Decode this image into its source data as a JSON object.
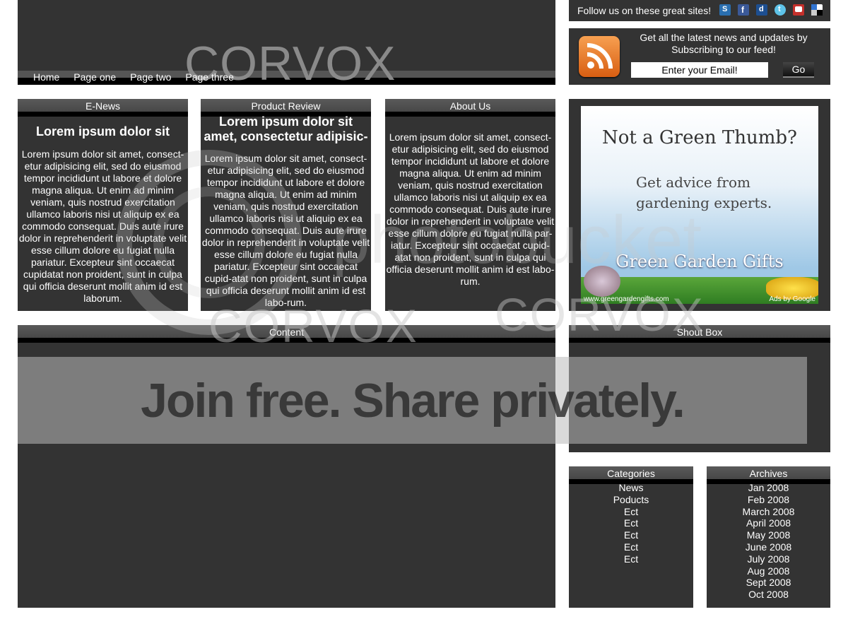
{
  "header": {
    "logo": "CORVOX",
    "nav": [
      "Home",
      "Page one",
      "Page two",
      "Page three"
    ]
  },
  "follow": {
    "text": "Follow us on these great sites!",
    "icons": [
      "stumbleupon-icon",
      "facebook-icon",
      "digg-icon",
      "twitter-icon",
      "youtube-icon",
      "delicious-icon"
    ]
  },
  "feed": {
    "text": "Get all the latest news and updates by Subscribing to our feed!",
    "email_value": "Enter your Email!",
    "go_label": "Go"
  },
  "enews": {
    "title": "E-News",
    "heading": "Lorem ipsum dolor sit",
    "body": "Lorem ipsum dolor sit amet, consect-etur adipisicing elit, sed do eiusmod tempor incididunt ut labore et dolore magna aliqua. Ut enim ad minim veniam, quis nostrud exercitation ullamco laboris nisi ut aliquip ex ea commodo consequat. Duis aute irure dolor in reprehenderit in voluptate velit esse cillum dolore eu fugiat nulla pariatur. Excepteur sint occaecat cupidatat non proident, sunt in culpa qui officia deserunt mollit anim id est laborum."
  },
  "review": {
    "title": "Product Review",
    "heading": "Lorem ipsum dolor sit amet, consectetur adipisic-",
    "body": "Lorem ipsum dolor sit amet, consect-etur adipisicing elit, sed do eiusmod tempor incididunt ut labore et dolore magna aliqua. Ut enim ad minim veniam, quis nostrud exercitation ullamco laboris nisi ut aliquip ex ea commodo consequat. Duis aute irure dolor in reprehenderit in voluptate velit esse cillum dolore eu fugiat nulla pariatur. Excepteur sint occaecat cupid-atat non proident, sunt in culpa qui officia deserunt mollit anim id est labo-rum."
  },
  "about": {
    "title": "About Us",
    "body": "Lorem ipsum dolor sit amet, consect-etur adipisicing elit, sed do eiusmod tempor incididunt ut labore et dolore magna aliqua. Ut enim ad minim veniam, quis nostrud exercitation ullamco laboris nisi ut aliquip ex ea commodo consequat. Duis aute irure dolor in reprehenderit in voluptate velit esse cillum dolore eu fugiat nulla par-iatur. Excepteur sint occaecat cupid-atat non proident, sunt in culpa qui officia deserunt mollit anim id est labo-rum."
  },
  "ad": {
    "headline": "Not a Green Thumb?",
    "sub1": "Get advice from",
    "sub2": "gardening experts.",
    "brand": "Green Garden Gifts",
    "url": "www.greengardengifts.com",
    "ads_by": "Ads by Google"
  },
  "content": {
    "title": "Content"
  },
  "shoutbox": {
    "title": "Shout Box"
  },
  "categories": {
    "title": "Categories",
    "items": [
      "News",
      "Poducts",
      "Ect",
      "Ect",
      "Ect",
      "Ect",
      "Ect"
    ]
  },
  "archives": {
    "title": "Archives",
    "items": [
      "Jan 2008",
      "Feb 2008",
      "March 2008",
      "April 2008",
      "May 2008",
      "June 2008",
      "July 2008",
      "Aug 2008",
      "Sept 2008",
      "Oct 2008"
    ]
  },
  "watermark": {
    "banner": "Join free. Share privately.",
    "brand": "photobucket",
    "logo_repeat": "CORVOX"
  }
}
